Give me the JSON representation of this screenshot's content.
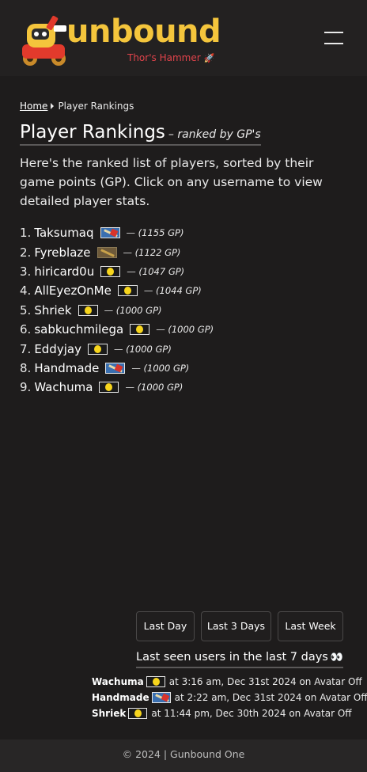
{
  "brand": {
    "name": "unbound",
    "subtitle": "Thor's Hammer",
    "subtitle_icon": "rocket-icon"
  },
  "breadcrumb": {
    "home": "Home",
    "current": "Player Rankings"
  },
  "page": {
    "title": "Player Rankings",
    "subtitle": "– ranked by GP's",
    "intro": "Here's the ranked list of players, sorted by their game points (GP). Click on any username to view detailed player stats."
  },
  "rankings": [
    {
      "rank": "1.",
      "user": "Taksumaq",
      "badge": "hammer-icon",
      "gp": "— (1155 GP)"
    },
    {
      "rank": "2.",
      "user": "Fyreblaze",
      "badge": "brown-hammer-icon",
      "gp": "— (1122 GP)"
    },
    {
      "rank": "3.",
      "user": "hiricard0u",
      "badge": "egg-icon",
      "gp": "— (1047 GP)"
    },
    {
      "rank": "4.",
      "user": "AllEyezOnMe",
      "badge": "egg-icon",
      "gp": "— (1044 GP)"
    },
    {
      "rank": "5.",
      "user": "Shriek",
      "badge": "egg-icon",
      "gp": "— (1000 GP)"
    },
    {
      "rank": "6.",
      "user": "sabkuchmilega",
      "badge": "egg-icon",
      "gp": "— (1000 GP)"
    },
    {
      "rank": "7.",
      "user": "Eddyjay",
      "badge": "egg-icon",
      "gp": "— (1000 GP)"
    },
    {
      "rank": "8.",
      "user": "Handmade",
      "badge": "hammer-icon",
      "gp": "— (1000 GP)"
    },
    {
      "rank": "9.",
      "user": "Wachuma",
      "badge": "egg-icon",
      "gp": "— (1000 GP)"
    }
  ],
  "filters": {
    "last_day": "Last Day",
    "last_3_days": "Last 3 Days",
    "last_week": "Last Week"
  },
  "last_seen": {
    "title": "Last seen users in the last 7 days",
    "icon": "eyes-icon",
    "entries": [
      {
        "user": "Wachuma",
        "badge": "egg-icon",
        "when": "at 3:16 am, Dec 31st 2024 on Avatar Off"
      },
      {
        "user": "Handmade",
        "badge": "hammer-icon",
        "when": "at 2:22 am, Dec 31st 2024 on Avatar Off"
      },
      {
        "user": "Shriek",
        "badge": "egg-icon",
        "when": "at 11:44 pm, Dec 30th 2024 on Avatar Off"
      }
    ]
  },
  "footer": {
    "text": "© 2024 | Gunbound One"
  },
  "colors": {
    "background": "#1e1c1c",
    "header": "#232121",
    "brand_yellow": "#f4c53c",
    "subtitle_red": "#e0434b"
  }
}
